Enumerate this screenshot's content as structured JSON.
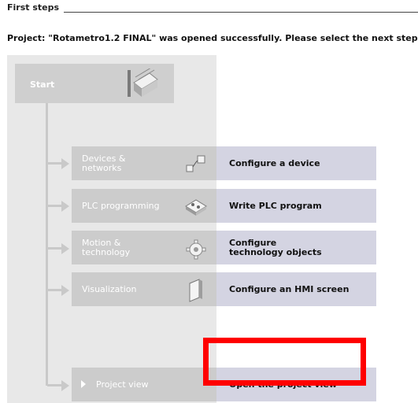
{
  "header": {
    "section_title": "First steps",
    "status_message": "Project: \"Rotametro1.2 FINAL\" was opened successfully. Please select the next step:"
  },
  "start": {
    "label": "Start",
    "icon": "start-stairs-icon"
  },
  "steps": [
    {
      "label": "Devices &\nnetworks",
      "action": "Configure a device",
      "icon": "devices-networks-icon"
    },
    {
      "label": "PLC programming",
      "action": "Write PLC program",
      "icon": "plc-programming-icon"
    },
    {
      "label": "Motion &\ntechnology",
      "action": "Configure\ntechnology objects",
      "icon": "gear-icon"
    },
    {
      "label": "Visualization",
      "action": "Configure an HMI screen",
      "icon": "hmi-screen-icon"
    }
  ],
  "project_view": {
    "label": "Project view",
    "action": "Open the project view",
    "icon": "triangle-right-icon"
  },
  "colors": {
    "panel_gray": "#e8e8e8",
    "item_gray": "#cccccc",
    "action_lilac": "#d4d4e2",
    "highlight_red": "#ff0000"
  }
}
